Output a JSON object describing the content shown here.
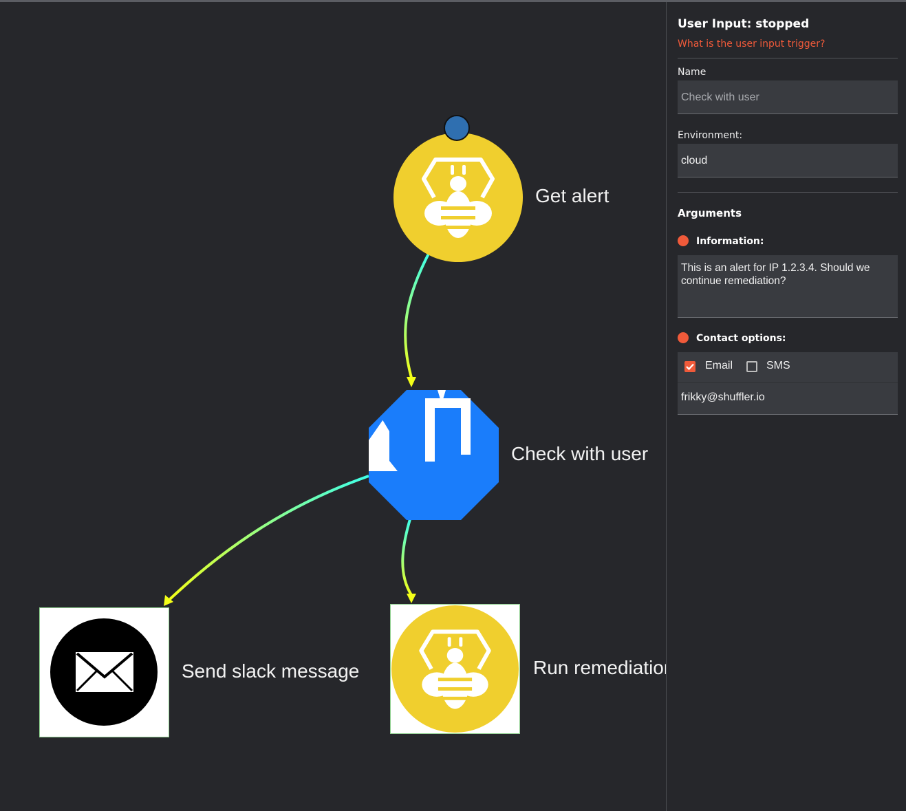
{
  "workflow": {
    "nodes": {
      "get_alert": {
        "label": "Get alert",
        "icon": "thehive-bee-icon"
      },
      "check_user": {
        "label": "Check with user",
        "icon": "user-input-hand-icon"
      },
      "send_slack": {
        "label": "Send slack message",
        "icon": "envelope-icon"
      },
      "remediation": {
        "label": "Run remediation",
        "icon": "thehive-bee-icon"
      }
    },
    "colors": {
      "edge_start": "#3fffe8",
      "edge_end": "#f4ff18",
      "start_dot": "#2f6fb0",
      "hive_yellow": "#f0cf2e",
      "user_input_blue": "#1a7dfb"
    }
  },
  "sidebar": {
    "title": "User Input: stopped",
    "help_link": "What is the user input trigger?",
    "name_label": "Name",
    "name_value": "Check with user",
    "environment_label": "Environment:",
    "environment_value": "cloud",
    "arguments_header": "Arguments",
    "information_label": "Information:",
    "information_value": "This is an alert for IP 1.2.3.4. Should we continue remediation?",
    "contact_label": "Contact options:",
    "email_option": {
      "label": "Email",
      "checked": true
    },
    "sms_option": {
      "label": "SMS",
      "checked": false
    },
    "contact_value": "frikky@shuffler.io",
    "accent_color": "#f05a3a"
  }
}
